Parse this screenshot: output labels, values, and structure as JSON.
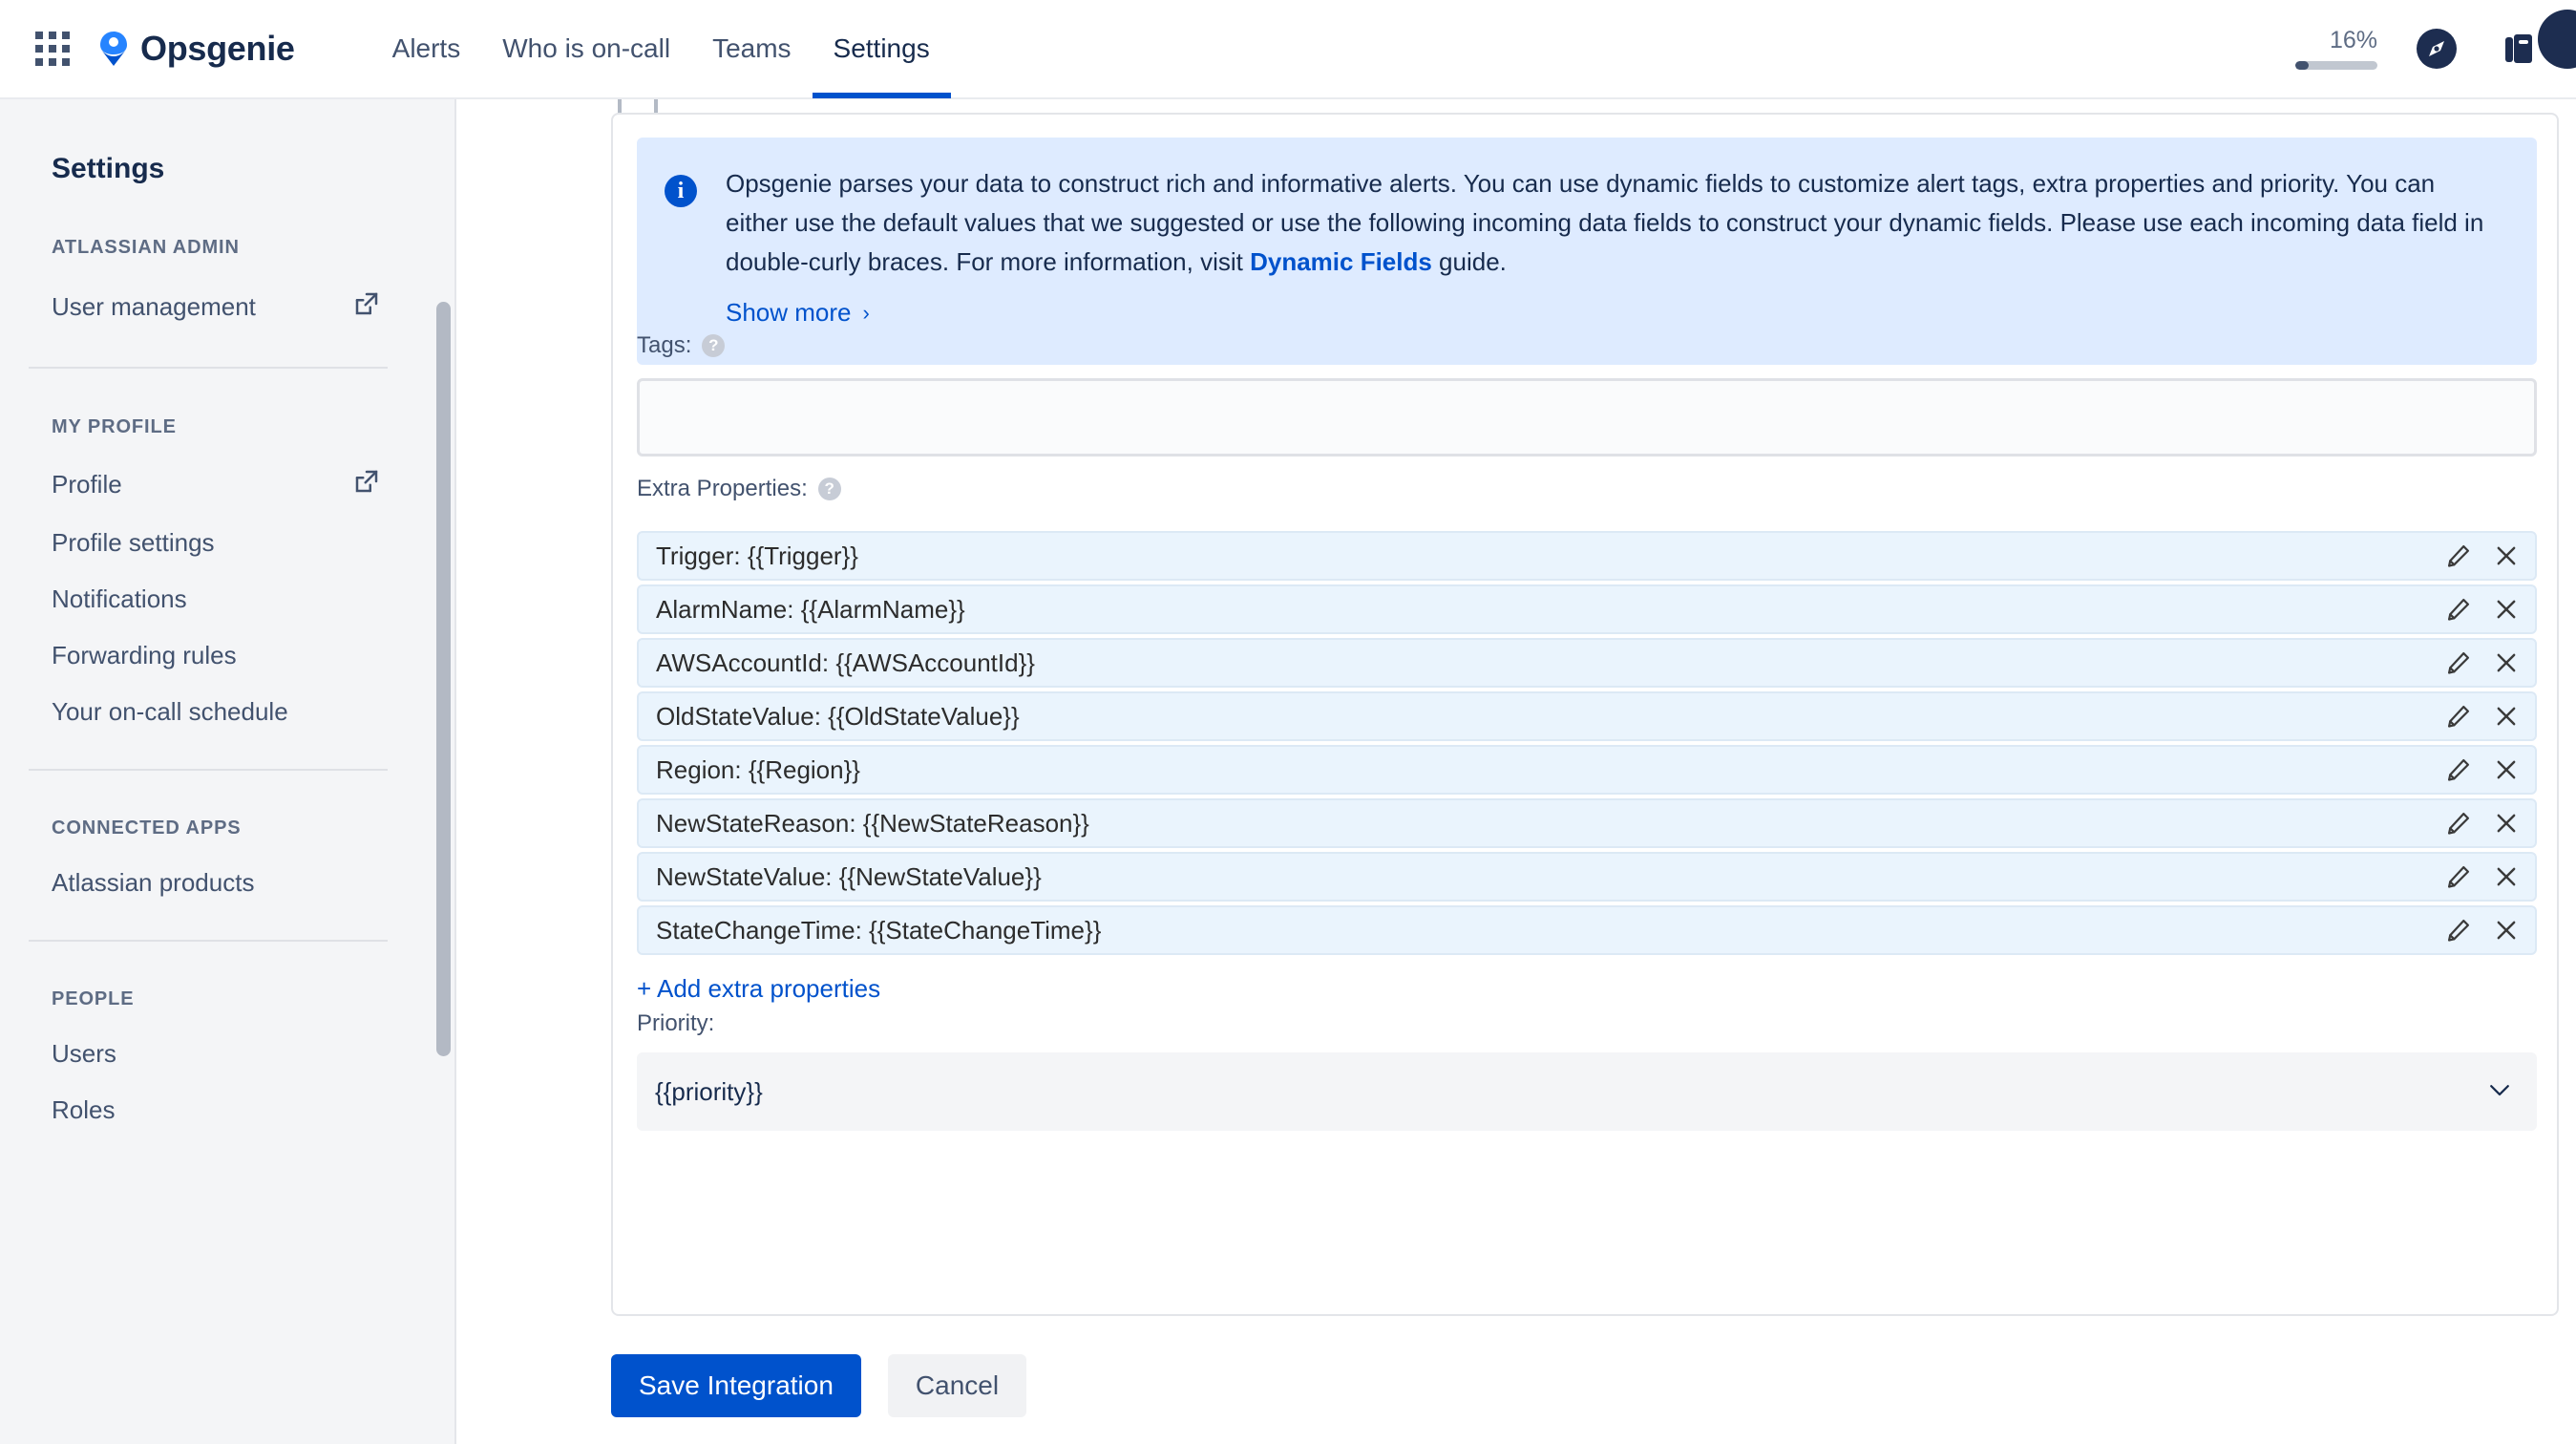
{
  "topnav": {
    "app_switcher_icon": "grid-apps-icon",
    "brand": "Opsgenie",
    "tabs": [
      {
        "label": "Alerts",
        "active": false
      },
      {
        "label": "Who is on-call",
        "active": false
      },
      {
        "label": "Teams",
        "active": false
      },
      {
        "label": "Settings",
        "active": true
      }
    ],
    "progress": {
      "percent_label": "16%",
      "percent_value": 16
    },
    "icons": [
      "compass-icon",
      "notebook-icon",
      "avatar-icon"
    ],
    "accent_color": "#0052cc"
  },
  "sidebar": {
    "title": "Settings",
    "groups": [
      {
        "heading": "ATLASSIAN ADMIN",
        "items": [
          {
            "label": "User management",
            "external": true
          }
        ]
      },
      {
        "heading": "MY PROFILE",
        "items": [
          {
            "label": "Profile",
            "external": true
          },
          {
            "label": "Profile settings",
            "external": false
          },
          {
            "label": "Notifications",
            "external": false
          },
          {
            "label": "Forwarding rules",
            "external": false
          },
          {
            "label": "Your on-call schedule",
            "external": false
          }
        ]
      },
      {
        "heading": "CONNECTED APPS",
        "items": [
          {
            "label": "Atlassian products",
            "external": false
          }
        ]
      },
      {
        "heading": "PEOPLE",
        "items": [
          {
            "label": "Users",
            "external": false
          },
          {
            "label": "Roles",
            "external": false
          }
        ]
      }
    ]
  },
  "main": {
    "banner": {
      "icon": "info-icon",
      "text_part_1": "Opsgenie parses your data to construct rich and informative alerts. You can use dynamic fields to customize alert tags, extra properties and priority. You can either use the default values that we suggested or use the following incoming data fields to construct your dynamic fields. Please use each incoming data field in double-curly braces. For more information, visit ",
      "link_label": "Dynamic Fields",
      "text_part_2": " guide.",
      "show_more_label": "Show more",
      "show_more_chevron": "›",
      "background_color": "#deebff"
    },
    "tags": {
      "label": "Tags:",
      "value": "",
      "placeholder": ""
    },
    "extra_properties": {
      "label": "Extra Properties:",
      "rows": [
        "Trigger: {{Trigger}}",
        "AlarmName: {{AlarmName}}",
        "AWSAccountId: {{AWSAccountId}}",
        "OldStateValue: {{OldStateValue}}",
        "Region: {{Region}}",
        "NewStateReason: {{NewStateReason}}",
        "NewStateValue: {{NewStateValue}}",
        "StateChangeTime: {{StateChangeTime}}"
      ],
      "row_edit_icon": "pencil-icon",
      "row_delete_icon": "close-x-icon",
      "add_link_label": "+ Add extra properties"
    },
    "priority": {
      "label": "Priority:",
      "value": "{{priority}}"
    },
    "buttons": {
      "save_label": "Save Integration",
      "cancel_label": "Cancel"
    }
  }
}
